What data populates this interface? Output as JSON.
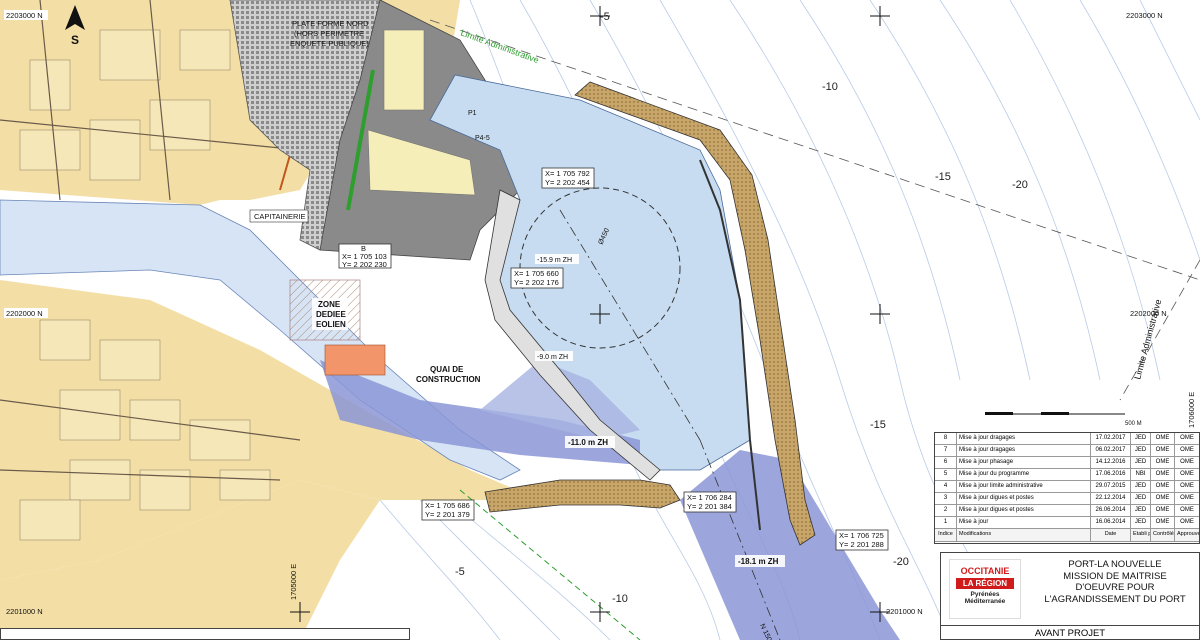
{
  "map": {
    "labels": {
      "plateforme": [
        "PLATE FORME NORD",
        "(HORS PERIMETRE",
        "ENQUETE PUBLIQUE)"
      ],
      "capitainerie": "CAPITAINERIE",
      "zone_eolien": [
        "ZONE",
        "DEDIEE",
        "EOLIEN"
      ],
      "quai": [
        "QUAI DE",
        "CONSTRUCTION"
      ],
      "limite_admin_top": "Limite Administrative",
      "limite_admin_right": "Limite Administrative",
      "p1": "P1",
      "p45": "P4-5",
      "circle_diam": "Ø450",
      "north": "S",
      "scale_end": "500 M"
    },
    "depths": {
      "d_159": "-15.9 m ZH",
      "d_90": "-9.0 m ZH",
      "d_110": "-11.0 m ZH",
      "d_181": "-18.1 m ZH",
      "m5_top": "-5",
      "m10_top": "-10",
      "m15_right": "-15",
      "m20_right": "-20",
      "m15_low": "-15",
      "m20_low": "-20",
      "m5_bottom": "-5",
      "m10_bottom": "-10",
      "n150": "N 150"
    },
    "coords": {
      "c1": [
        "X= 1 705 792",
        "Y= 2 202 454"
      ],
      "c2": [
        "X= 1 705 660",
        "Y= 2 202 176"
      ],
      "c3": [
        "X= 1 705 103",
        "Y= 2 202 230"
      ],
      "c3_label": "B",
      "c4": [
        "X= 1 706 284",
        "Y= 2 201 384"
      ],
      "c5": [
        "X= 1 705 686",
        "Y= 2 201 379"
      ],
      "c6": [
        "X= 1 706 725",
        "Y= 2 201 288"
      ]
    },
    "grid_labels": {
      "n2203000_left": "2203000 N",
      "n2203000_right": "2203000 N",
      "n2202000_left": "2202000 N",
      "n2202000_right": "2202000 N",
      "n2201000_left": "2201000 N",
      "n2201000_right": "2201000 N",
      "e1705000": "1705000 E",
      "e1706000": "1706000 E"
    },
    "colors": {
      "land": "#f3dfa6",
      "urban": "#e9d29a",
      "basin": "#c7dcf0",
      "dredge": "#8b96d6",
      "dike": "#c8a66a",
      "platform": "#8a8a8a",
      "yellow_fill": "#f6eeb8",
      "green_line": "#2e9e2e",
      "rail": "#c0561b"
    }
  },
  "revisions": {
    "headers": [
      "Indice",
      "Modifications",
      "Date",
      "Etabli par",
      "Contrôlé par",
      "Approuvé par"
    ],
    "rows": [
      {
        "i": "8",
        "mod": "Mise à jour  dragages",
        "date": "17.02.2017",
        "e": "JED",
        "c": "OME",
        "a": "OME"
      },
      {
        "i": "7",
        "mod": "Mise à jour  dragages",
        "date": "06.02.2017",
        "e": "JED",
        "c": "OME",
        "a": "OME"
      },
      {
        "i": "6",
        "mod": "Mise à jour phasage",
        "date": "14.12.2016",
        "e": "JED",
        "c": "OME",
        "a": "OME"
      },
      {
        "i": "5",
        "mod": "Mise à jour du programme",
        "date": "17.06.2016",
        "e": "NBI",
        "c": "OME",
        "a": "OME"
      },
      {
        "i": "4",
        "mod": "Mise à jour limite administrative",
        "date": "29.07.2015",
        "e": "JED",
        "c": "OME",
        "a": "OME"
      },
      {
        "i": "3",
        "mod": "Mise à jour digues et postes",
        "date": "22.12.2014",
        "e": "JED",
        "c": "OME",
        "a": "OME"
      },
      {
        "i": "2",
        "mod": "Mise à jour digues et postes",
        "date": "26.06.2014",
        "e": "JED",
        "c": "OME",
        "a": "OME"
      },
      {
        "i": "1",
        "mod": "Mise à jour",
        "date": "16.06.2014",
        "e": "JED",
        "c": "OME",
        "a": "OME"
      }
    ]
  },
  "titleblock": {
    "logo": [
      "OCCITANIE",
      "LA RÉGION",
      "Pyrénées",
      "Méditerranée"
    ],
    "title": [
      "PORT-LA NOUVELLE",
      "MISSION DE MAITRISE",
      "D'OEUVRE POUR",
      "L'AGRANDISSEMENT DU PORT"
    ],
    "phase": "AVANT PROJET"
  }
}
